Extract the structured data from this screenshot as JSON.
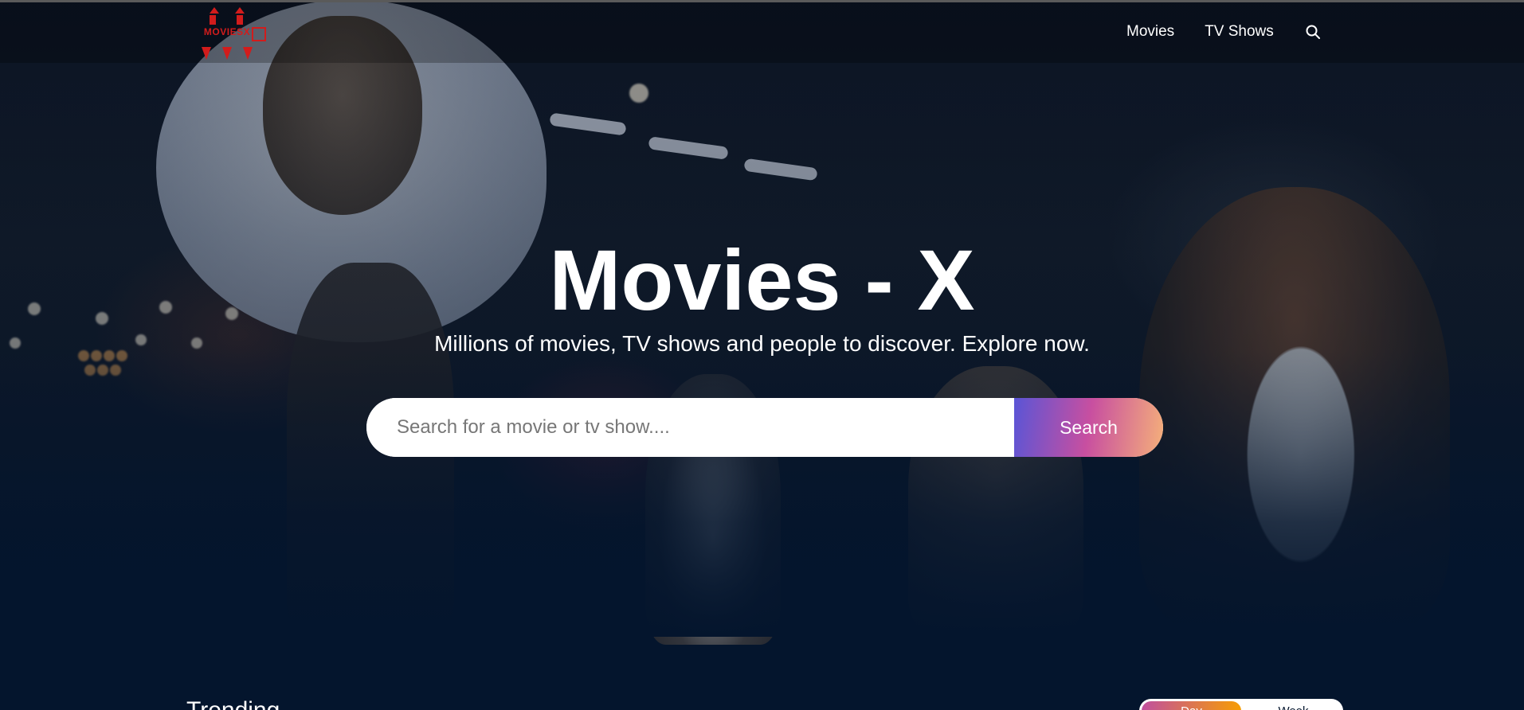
{
  "header": {
    "logo_text": "MOVIESX",
    "nav": [
      {
        "label": "Movies"
      },
      {
        "label": "TV Shows"
      }
    ],
    "search_icon": "search-icon"
  },
  "hero": {
    "title": "Movies - X",
    "subtitle": "Millions of movies, TV shows and people to discover. Explore now.",
    "search": {
      "placeholder": "Search for a movie or tv show....",
      "button_label": "Search"
    }
  },
  "trending": {
    "title": "Trending",
    "tabs": [
      {
        "label": "Day"
      },
      {
        "label": "Week"
      }
    ]
  },
  "colors": {
    "background": "#04152d",
    "accent_gradient_start": "#5a55d6",
    "accent_gradient_mid": "#c84fa0",
    "accent_gradient_end": "#f5b07a",
    "logo_red": "#d21c1c"
  }
}
